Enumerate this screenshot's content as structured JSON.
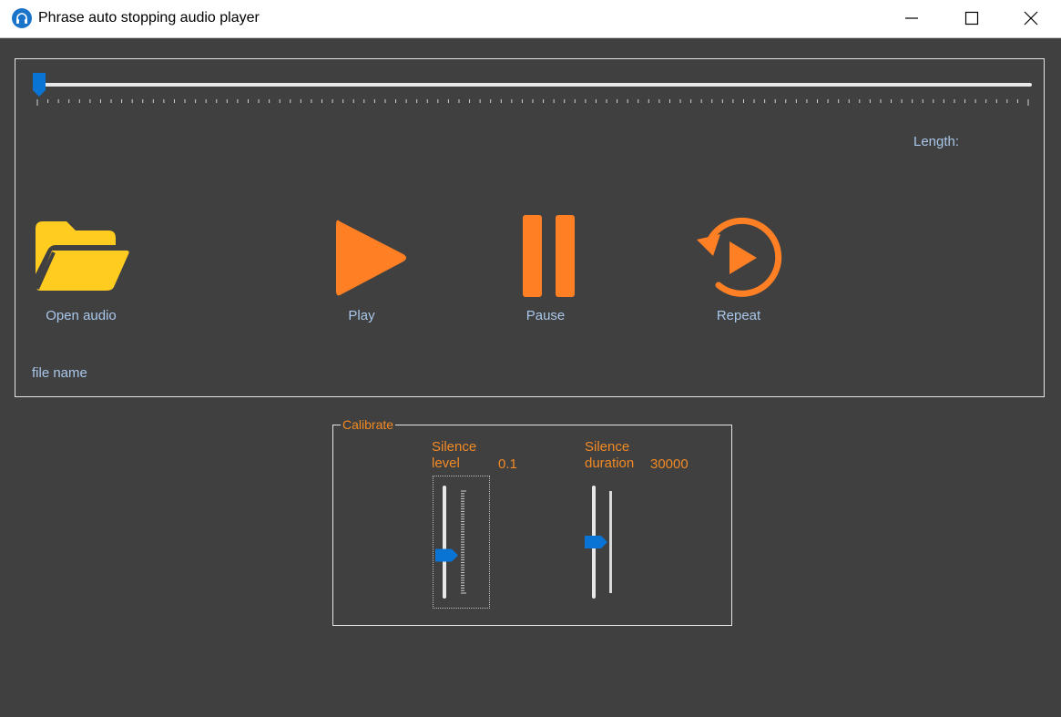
{
  "window": {
    "title": "Phrase auto stopping audio player",
    "app_icon": "headphones-icon",
    "controls": [
      "minimize-icon",
      "maximize-icon",
      "close-icon"
    ]
  },
  "player": {
    "seek_position": 0,
    "length_label": "Length:",
    "file_name": "file name",
    "buttons": {
      "open": {
        "label": "Open audio",
        "icon": "folder-open-icon"
      },
      "play": {
        "label": "Play",
        "icon": "play-icon"
      },
      "pause": {
        "label": "Pause",
        "icon": "pause-icon"
      },
      "repeat": {
        "label": "Repeat",
        "icon": "replay-icon"
      }
    }
  },
  "calibrate": {
    "title": "Calibrate",
    "silence_level": {
      "label_line1": "Silence",
      "label_line2": "level",
      "value": "0.1",
      "slider_fraction": 0.63
    },
    "silence_duration": {
      "label_line1": "Silence",
      "label_line2": "duration",
      "value": "30000",
      "slider_fraction": 0.5
    }
  },
  "colors": {
    "background": "#404040",
    "accent": "#f28a24",
    "slider_thumb": "#0a74d4",
    "label_text": "#a9c7ea",
    "folder": "#ffcc1f"
  }
}
